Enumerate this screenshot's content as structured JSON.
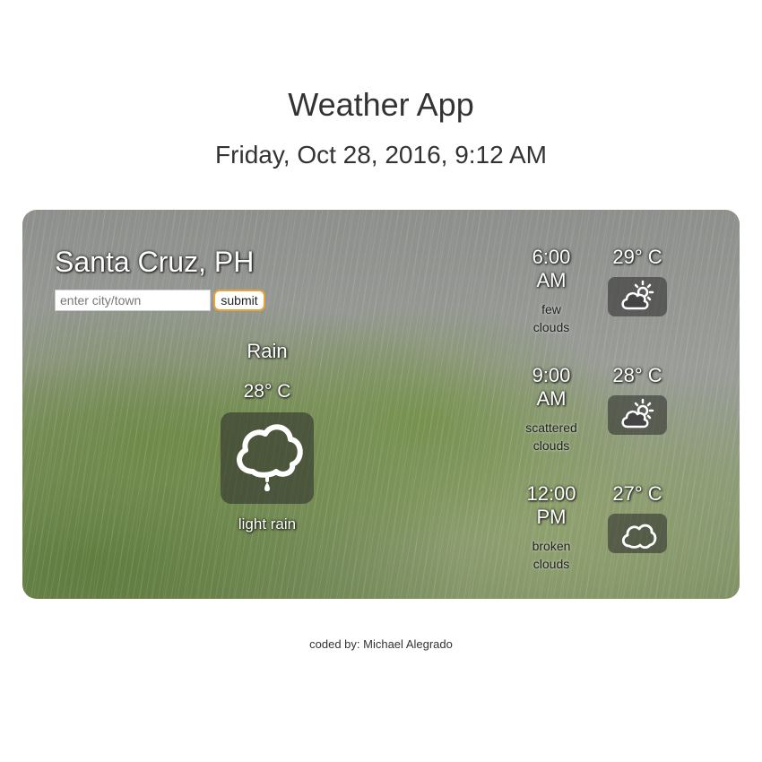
{
  "header": {
    "title": "Weather App",
    "datetime": "Friday, Oct 28, 2016, 9:12 AM"
  },
  "current": {
    "city": "Santa Cruz, PH",
    "search": {
      "placeholder": "enter city/town",
      "value": ""
    },
    "submit_label": "submit",
    "condition": "Rain",
    "temperature": "28° C",
    "description": "light rain",
    "icon": "rain-cloud-icon"
  },
  "forecast": [
    {
      "time_line1": "6:00",
      "time_line2": "AM",
      "desc_line1": "few",
      "desc_line2": "clouds",
      "temperature": "29° C",
      "icon": "partly-cloudy-icon"
    },
    {
      "time_line1": "9:00",
      "time_line2": "AM",
      "desc_line1": "scattered",
      "desc_line2": "clouds",
      "temperature": "28° C",
      "icon": "partly-cloudy-icon"
    },
    {
      "time_line1": "12:00",
      "time_line2": "PM",
      "desc_line1": "broken",
      "desc_line2": "clouds",
      "temperature": "27° C",
      "icon": "cloud-icon"
    }
  ],
  "footer": {
    "credit": "coded by: Michael Alegrado"
  },
  "colors": {
    "accent": "#e8a33a",
    "text": "#333333",
    "icon_bg": "#282828"
  }
}
